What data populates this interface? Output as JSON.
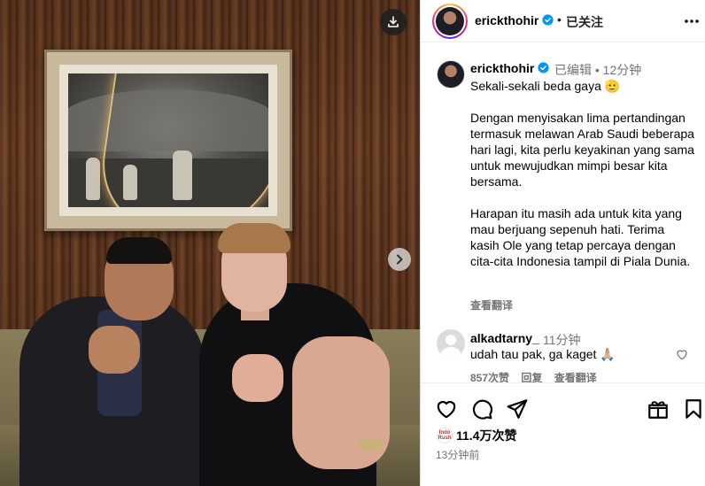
{
  "post": {
    "username": "erickthohir",
    "follow_status": "已关注",
    "header_dot": "•"
  },
  "caption": {
    "username": "erickthohir",
    "meta": "已编辑 • 12分钟",
    "text": "Sekali-sekali beda gaya 🫡\n\nDengan menyisakan lima pertandingan termasuk melawan Arab Saudi beberapa hari lagi, kita perlu keyakinan yang sama untuk mewujudkan mimpi besar kita bersama.\n\nHarapan itu masih ada untuk kita yang mau berjuang sepenuh hati. Terima kasih Ole yang tetap percaya dengan cita-cita Indonesia tampil di Piala Dunia.",
    "translate": "查看翻译"
  },
  "comment": {
    "username": "alkadtarny_",
    "time": "11分钟",
    "text": "udah tau pak, ga kaget 🙏🏼",
    "likes": "857次赞",
    "reply": "回复",
    "translate": "查看翻译"
  },
  "footer": {
    "likes": "11.4万次赞",
    "time": "13分钟前",
    "mini_avatar_text": "Indo Rush"
  },
  "icons": {
    "download": "download-icon",
    "next": "chevron-right-icon",
    "verified": "verified-badge-icon",
    "more": "more-horizontal-icon",
    "like": "heart-icon",
    "comment": "comment-icon",
    "share": "share-icon",
    "gift": "gift-icon",
    "save": "bookmark-icon"
  },
  "colors": {
    "verified": "#0095f6",
    "meta_text": "#737373"
  }
}
